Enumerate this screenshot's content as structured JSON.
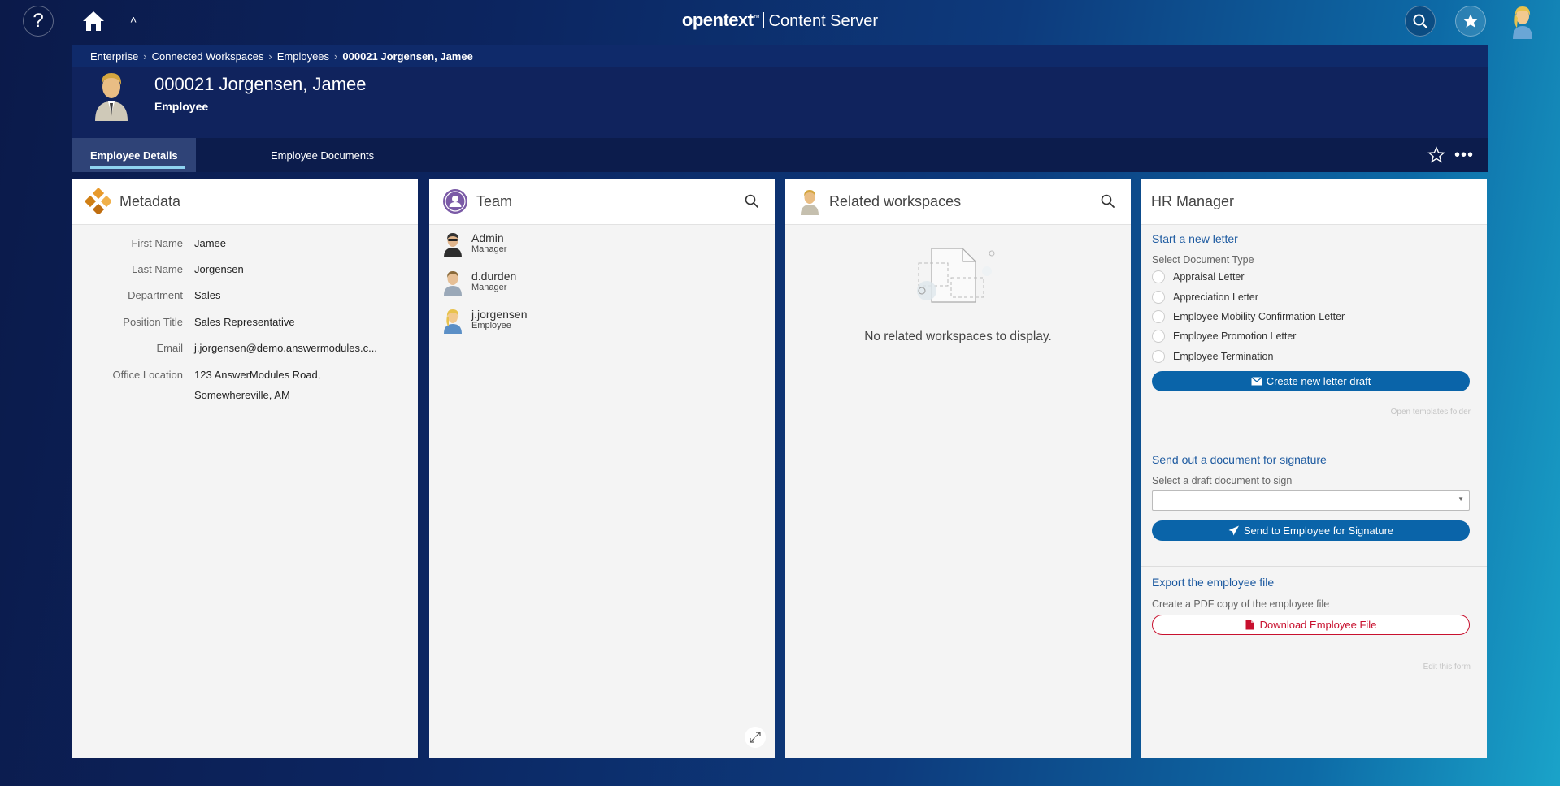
{
  "topbar": {
    "help_glyph": "?",
    "brand_logo": "opentext",
    "brand_tm": "™",
    "brand_product": "Content Server"
  },
  "breadcrumb": {
    "items": [
      "Enterprise",
      "Connected Workspaces",
      "Employees"
    ],
    "current": "000021 Jorgensen, Jamee"
  },
  "workspace": {
    "title": "000021 Jorgensen, Jamee",
    "type": "Employee"
  },
  "tabs": [
    "Employee Details",
    "Employee Documents"
  ],
  "tab_more": "•••",
  "metadata": {
    "title": "Metadata",
    "fields": [
      {
        "label": "First Name",
        "value": "Jamee"
      },
      {
        "label": "Last Name",
        "value": "Jorgensen"
      },
      {
        "label": "Department",
        "value": "Sales"
      },
      {
        "label": "Position Title",
        "value": "Sales Representative"
      },
      {
        "label": "Email",
        "value": "j.jorgensen@demo.answermodules.c..."
      },
      {
        "label": "Office Location",
        "value": "123 AnswerModules Road, Somewhereville, AM"
      }
    ]
  },
  "team": {
    "title": "Team",
    "members": [
      {
        "name": "Admin",
        "role": "Manager"
      },
      {
        "name": "d.durden",
        "role": "Manager"
      },
      {
        "name": "j.jorgensen",
        "role": "Employee"
      }
    ]
  },
  "related": {
    "title": "Related workspaces",
    "empty_text": "No related workspaces to display."
  },
  "hr": {
    "title": "HR Manager",
    "letter_section": "Start a new letter",
    "select_type_label": "Select Document Type",
    "letter_types": [
      "Appraisal Letter",
      "Appreciation Letter",
      "Employee Mobility Confirmation Letter",
      "Employee Promotion Letter",
      "Employee Termination"
    ],
    "create_button": "Create new letter draft",
    "open_templates": "Open templates folder",
    "signature_section": "Send out a document for signature",
    "select_draft_label": "Select a draft document to sign",
    "select_draft_value": "",
    "send_button": "Send to Employee for Signature",
    "export_section": "Export the employee file",
    "export_desc": "Create a PDF copy of the employee file",
    "download_button": "Download Employee File",
    "edit_form": "Edit this form"
  },
  "colors": {
    "accent": "#0a64a9",
    "danger": "#c8102e",
    "section_title": "#1d5aa0"
  }
}
